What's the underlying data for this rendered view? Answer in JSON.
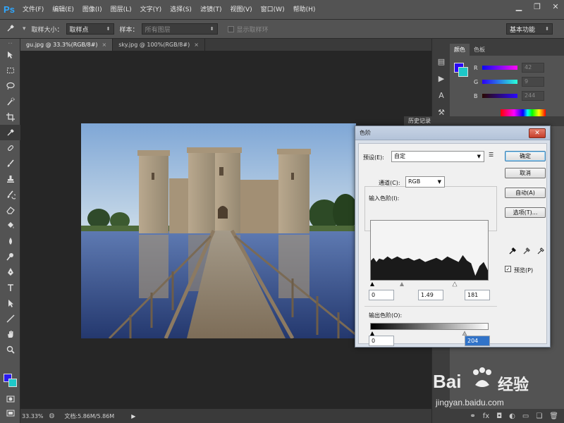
{
  "app": {
    "logo": "Ps"
  },
  "menu": [
    "文件(F)",
    "编辑(E)",
    "图像(I)",
    "图层(L)",
    "文字(Y)",
    "选择(S)",
    "滤镜(T)",
    "视图(V)",
    "窗口(W)",
    "帮助(H)"
  ],
  "window_controls": {
    "minimize": "▁",
    "restore": "❐",
    "close": "✕"
  },
  "options": {
    "sample_size_label": "取样大小：",
    "sample_size_value": "取样点",
    "sample_label": "样本：",
    "sample_value": "所有图层",
    "show_ring_label": "显示取样环",
    "workspace": "基本功能"
  },
  "doc_tabs": [
    {
      "label": "gu.jpg @ 33.3%(RGB/8#)",
      "active": true
    },
    {
      "label": "sky.jpg @ 100%(RGB/8#)",
      "active": false
    }
  ],
  "status": {
    "zoom": "33.33%",
    "doc": "文档:5.86M/5.86M"
  },
  "color_panel": {
    "tabs": [
      "颜色",
      "色板"
    ],
    "r_label": "R",
    "g_label": "G",
    "b_label": "B",
    "r": "42",
    "g": "9",
    "b": "244",
    "fg_color": "#2a09f4",
    "bg_color": "#1ec8c8"
  },
  "history_panel": {
    "title": "历史记录"
  },
  "levels": {
    "title": "色阶",
    "preset_label": "预设(E):",
    "preset_value": "自定",
    "channel_label": "通道(C):",
    "channel_value": "RGB",
    "input_label": "输入色阶(I):",
    "input_black": "0",
    "input_gamma": "1.49",
    "input_white": "181",
    "output_label": "输出色阶(O):",
    "output_black": "0",
    "output_white": "204",
    "buttons": {
      "ok": "确定",
      "cancel": "取消",
      "auto": "自动(A)",
      "options": "选项(T)..."
    },
    "preview_label": "预览(P)",
    "preview_checked": true
  },
  "watermark": {
    "brand": "Bai",
    "brand2": "经验",
    "url": "jingyan.baidu.com"
  }
}
